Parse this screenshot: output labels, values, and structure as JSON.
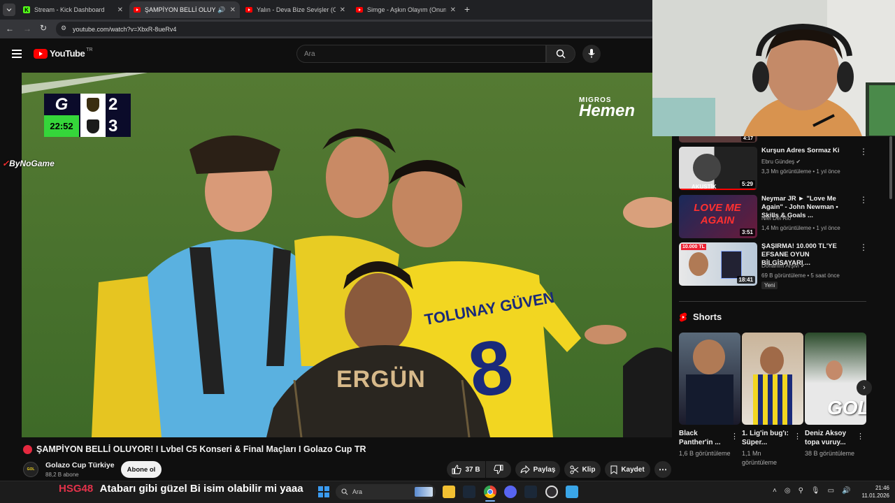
{
  "browser": {
    "tabs": [
      {
        "title": "Stream - Kick Dashboard",
        "favicon": "kick-icon",
        "color": "#53fc18"
      },
      {
        "title": "ŞAMPİYON BELLİ OLUYOR",
        "favicon": "youtube-icon",
        "color": "#ff0000"
      },
      {
        "title": "Yalın - Deva Bize Sevişler (Offici",
        "favicon": "youtube-icon",
        "color": "#ff0000"
      },
      {
        "title": "Simge - Aşkın Olayım (Onurr) -",
        "favicon": "youtube-icon",
        "color": "#ff0000"
      }
    ],
    "url": "youtube.com/watch?v=XbxR-8ueRv4"
  },
  "youtube": {
    "logo_text": "YouTube",
    "region": "TR",
    "search_placeholder": "Ara"
  },
  "video": {
    "title": "ŞAMPİYON BELLİ OLUYOR! I Lvbel C5 Konseri & Final Maçları I Golazo Cup TR",
    "score_home": "2",
    "score_away": "3",
    "clock": "22:52",
    "sponsor_top": "MIGROS",
    "sponsor_bottom": "Hemen",
    "watermark": "ByNoGame",
    "jersey_name_1": "TOLUNAY GÜVEN",
    "jersey_number_1": "8",
    "jersey_name_2": "ERGÜN"
  },
  "channel": {
    "name": "Golazo Cup Türkiye",
    "subscribers": "88,2 B abone",
    "subscribe_label": "Abone ol"
  },
  "actions": {
    "likes": "37 B",
    "share": "Paylaş",
    "clip": "Klip",
    "save": "Kaydet"
  },
  "sidebar": {
    "first_duration": "4:17",
    "videos": [
      {
        "title": "Kurşun Adres Sormaz Ki",
        "channel": "Ebru Gündeş",
        "verified": true,
        "meta": "3,3 Mn görüntüleme • 1 yıl önce",
        "duration": "5:29",
        "thumb_text": "AKUSTİK"
      },
      {
        "title": "Neymar JR ► \"Love Me Again\" - John Newman • Skills & Goals ...",
        "channel": "Niel Del Rio",
        "verified": false,
        "meta": "1,4 Mn görüntüleme • 1 yıl önce",
        "duration": "3:51",
        "thumb_text": "LOVE ME AGAIN"
      },
      {
        "title": "ŞAŞIRMA! 10.000 TL'YE EFSANE OYUN BİLGİSAYARI ...",
        "channel": "Donanım Arşivi",
        "verified": true,
        "meta": "69 B görüntüleme • 5 saat önce",
        "duration": "18:41",
        "thumb_text": "10.000 TL",
        "badge": "Yeni"
      }
    ],
    "shorts_heading": "Shorts",
    "shorts": [
      {
        "title": "Black Panther'in ...",
        "views": "1,6 B görüntüleme"
      },
      {
        "title": "1. Lig'in bug'ı: Süper...",
        "views": "1,1 Mn görüntüleme"
      },
      {
        "title": "Deniz Aksoy topa vuruy...",
        "views": "38 B görüntüleme",
        "thumb_text": "GOL"
      }
    ]
  },
  "overlay": {
    "chat_user": "HSG48",
    "chat_message": "Atabarı gibi güzel Bi isim olabilir mi yaaa"
  },
  "taskbar": {
    "search_placeholder": "Ara",
    "time": "21:46",
    "date": "11.01.2026"
  }
}
